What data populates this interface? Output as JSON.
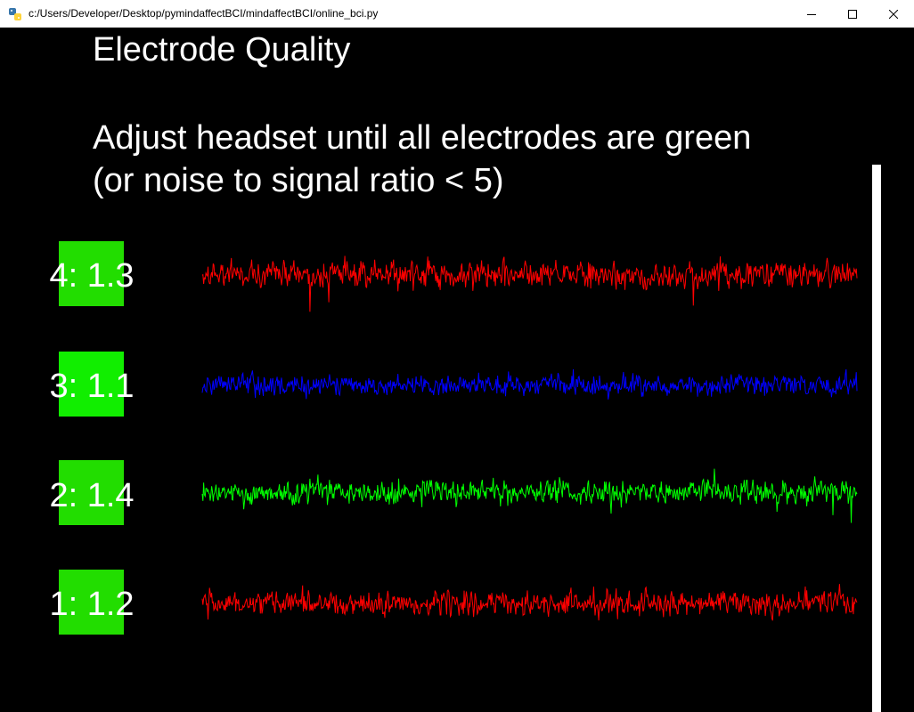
{
  "window": {
    "title": "c:/Users/Developer/Desktop/pymindaffectBCI/mindaffectBCI/online_bci.py"
  },
  "screen": {
    "heading": "Electrode Quality",
    "instruction_line1": "Adjust headset until all electrodes are green",
    "instruction_line2": "(or noise to signal ratio < 5)"
  },
  "channels": [
    {
      "label": "4: 1.3",
      "box_color": "#22dd00",
      "trace_color": "#ff0000"
    },
    {
      "label": "3: 1.1",
      "box_color": "#11ee00",
      "trace_color": "#0000ff"
    },
    {
      "label": "2: 1.4",
      "box_color": "#22dd00",
      "trace_color": "#00ff00"
    },
    {
      "label": "1: 1.2",
      "box_color": "#22dd00",
      "trace_color": "#ff0000"
    }
  ],
  "icons": {
    "app": "python-icon",
    "minimize": "minimize-icon",
    "maximize": "maximize-icon",
    "close": "close-icon"
  }
}
